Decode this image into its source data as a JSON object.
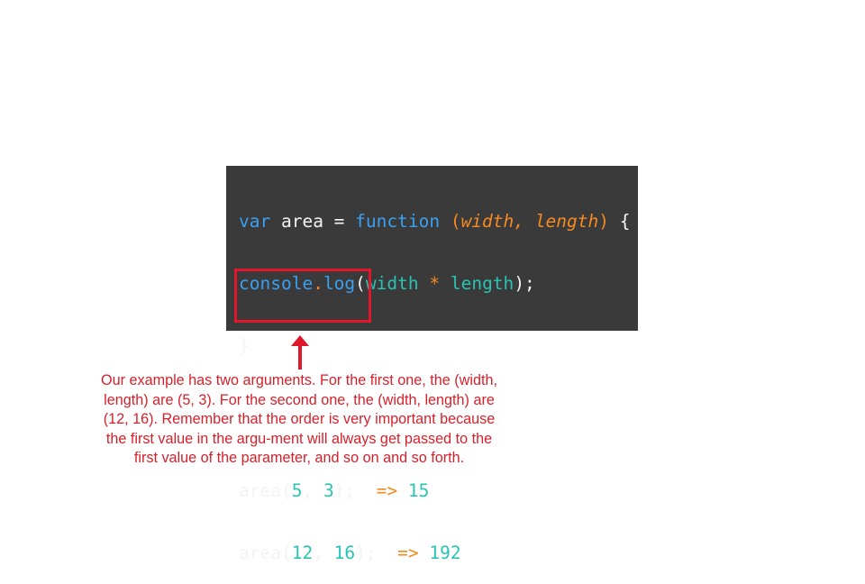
{
  "code": {
    "line1": {
      "kw_var": "var",
      "name": " area = ",
      "kw_function": "function",
      "paren_open": " (",
      "param1": "width",
      "comma": ", ",
      "param2": "length",
      "paren_close": ")",
      "brace": " {"
    },
    "line2": {
      "obj": "console",
      "dot": ".",
      "method": "log",
      "paren_open": "(",
      "arg1": "width",
      "op": " * ",
      "arg2": "length",
      "end": ");"
    },
    "line3": "}",
    "call1": {
      "fn": "area(",
      "a": "5",
      "sep": ", ",
      "b": "3",
      "end": ");",
      "gap": "  ",
      "arrow": "=>",
      "result": " 15"
    },
    "call2": {
      "fn": "area(",
      "a": "12",
      "sep": ", ",
      "b": "16",
      "end": ");",
      "gap": "  ",
      "arrow": "=>",
      "result": " 192"
    }
  },
  "caption": "Our example has two arguments. For the first one, the (width, length) are (5, 3). For the second one, the (width, length) are (12, 16). Remember that the order is very important because the first value in the argu-ment will always get passed to the first value of the parameter, and so on and so forth.",
  "colors": {
    "code_background": "#3a3a3a",
    "keyword": "#3aa0f0",
    "parameter": "#f58a1f",
    "number": "#29c4b4",
    "highlight": "#e0182b",
    "caption": "#d8202b"
  }
}
